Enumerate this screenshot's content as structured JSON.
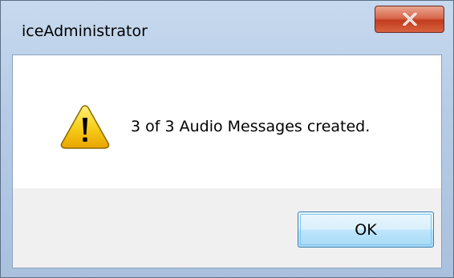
{
  "window": {
    "title": "iceAdministrator"
  },
  "close_button": {
    "icon": "close-icon"
  },
  "message": {
    "icon": "warning-icon",
    "text": "3 of 3 Audio Messages created."
  },
  "buttons": {
    "ok_label": "OK"
  },
  "colors": {
    "title_bar": "#b6cce6",
    "close_button": "#c23c1e",
    "ok_button_border": "#3c7fb1",
    "button_area": "#f0f0f0",
    "warning_fill": "#f5c400"
  }
}
